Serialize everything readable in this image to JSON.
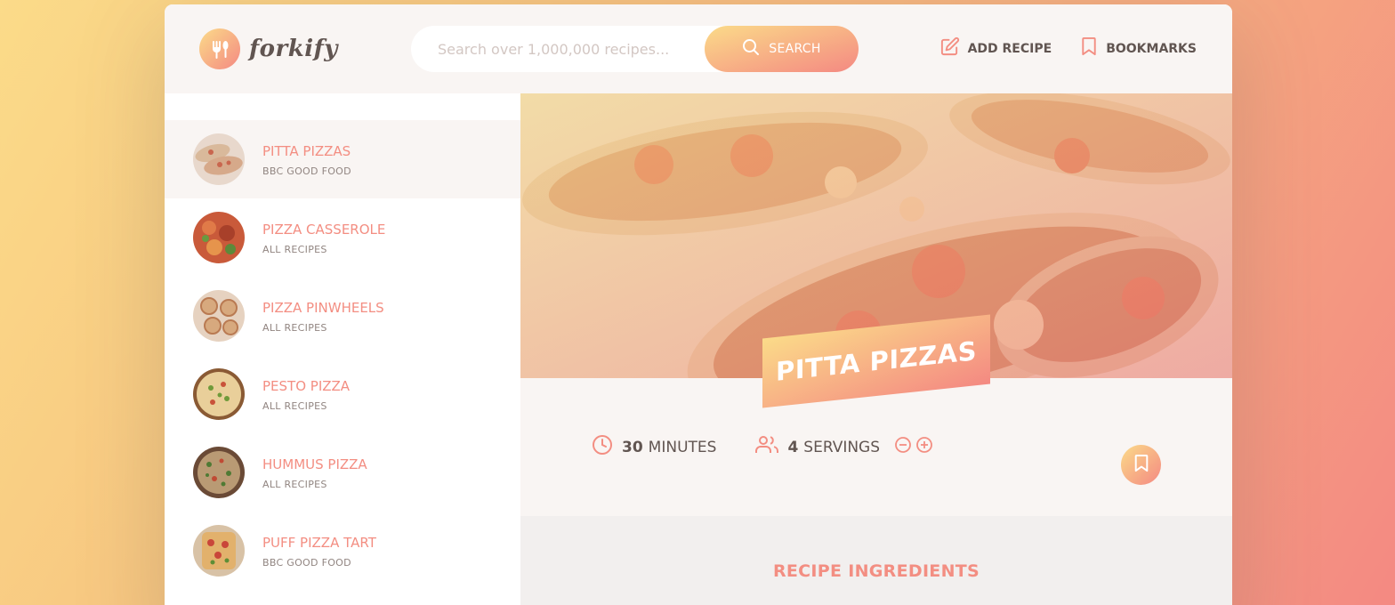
{
  "header": {
    "logo_text": "forkify",
    "search_placeholder": "Search over 1,000,000 recipes...",
    "search_button": "SEARCH",
    "nav": [
      {
        "label": "ADD RECIPE",
        "icon": "edit-icon"
      },
      {
        "label": "BOOKMARKS",
        "icon": "bookmark-icon"
      }
    ]
  },
  "results": [
    {
      "title": "PITTA PIZZAS",
      "publisher": "BBC GOOD FOOD",
      "active": true
    },
    {
      "title": "PIZZA CASSEROLE",
      "publisher": "ALL RECIPES",
      "active": false
    },
    {
      "title": "PIZZA PINWHEELS",
      "publisher": "ALL RECIPES",
      "active": false
    },
    {
      "title": "PESTO PIZZA",
      "publisher": "ALL RECIPES",
      "active": false
    },
    {
      "title": "HUMMUS PIZZA",
      "publisher": "ALL RECIPES",
      "active": false
    },
    {
      "title": "PUFF PIZZA TART",
      "publisher": "BBC GOOD FOOD",
      "active": false
    }
  ],
  "recipe": {
    "title": "PITTA PIZZAS",
    "minutes": "30",
    "minutes_label": "MINUTES",
    "servings": "4",
    "servings_label": "SERVINGS",
    "ingredients_heading": "RECIPE INGREDIENTS"
  },
  "colors": {
    "accent_start": "#fbdb89",
    "accent_end": "#f48982",
    "text": "#615551",
    "accent_text": "#f38e82"
  }
}
